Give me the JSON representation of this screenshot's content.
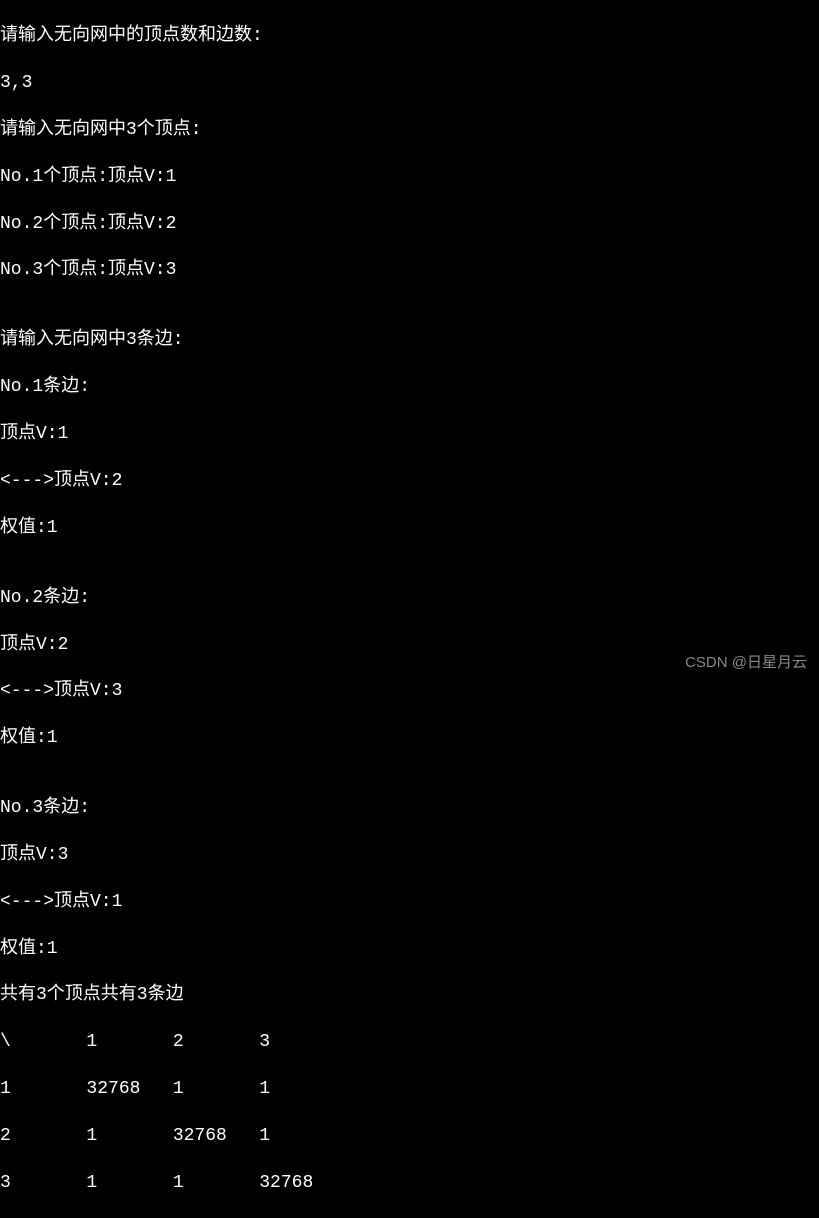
{
  "terminal": {
    "lines": [
      "请输入无向网中的顶点数和边数:",
      "3,3",
      "请输入无向网中3个顶点:",
      "No.1个顶点:顶点V:1",
      "No.2个顶点:顶点V:2",
      "No.3个顶点:顶点V:3",
      "",
      "请输入无向网中3条边:",
      "No.1条边:",
      "顶点V:1",
      "<--->顶点V:2",
      "权值:1",
      "",
      "No.2条边:",
      "顶点V:2",
      "<--->顶点V:3",
      "权值:1",
      "",
      "No.3条边:",
      "顶点V:3",
      "<--->顶点V:1",
      "权值:1",
      "共有3个顶点共有3条边",
      "\\       1       2       3",
      "1       32768   1       1",
      "2       1       32768   1",
      "3       1       1       32768"
    ]
  },
  "watermark": "CSDN @日星月云"
}
